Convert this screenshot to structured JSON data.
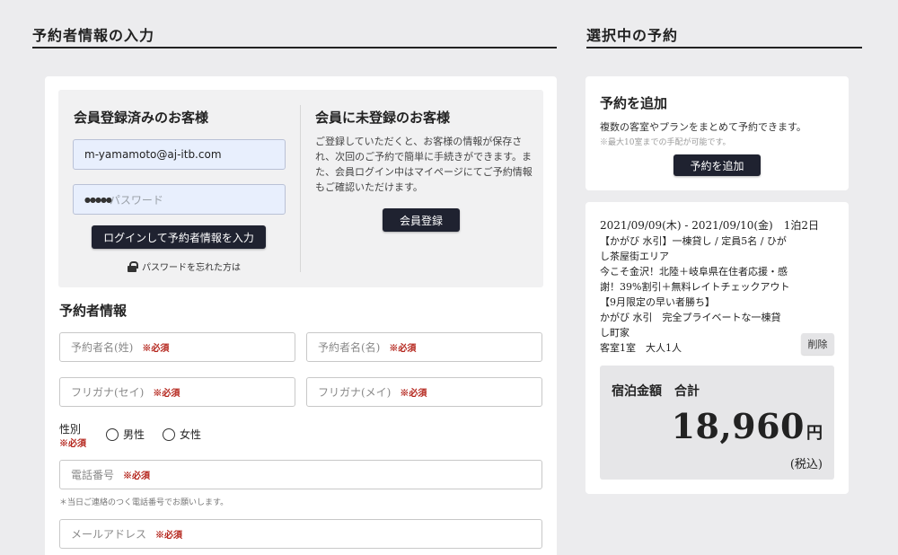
{
  "left_section": {
    "title": "予約者情報の入力"
  },
  "right_section": {
    "title": "選択中の予約"
  },
  "member_login": {
    "title": "会員登録済みのお客様",
    "email_value": "m-yamamoto@aj-itb.com",
    "password_placeholder": "パスワード",
    "password_value": "●●●●●",
    "login_button": "ログインして予約者情報を入力",
    "forgot_link": "パスワードを忘れた方は"
  },
  "guest": {
    "title": "会員に未登録のお客様",
    "description": [
      "ご登録していただくと、お客様の情報が保存さ",
      "れ、次回のご予約で簡単に手続きができます。ま",
      "た、会員ログイン中はマイページにてご予約情報",
      "もご確認いただけます。"
    ],
    "register_button": "会員登録"
  },
  "booker_info": {
    "title": "予約者情報",
    "required": "※必須",
    "last_name_placeholder": "予約者名(姓)",
    "first_name_placeholder": "予約者名(名)",
    "kana_last_placeholder": "フリガナ(セイ)",
    "kana_first_placeholder": "フリガナ(メイ)",
    "gender_label": "性別",
    "gender_options": [
      "男性",
      "女性"
    ],
    "phone_placeholder": "電話番号",
    "phone_hint": "＊当日ご連絡のつく電話番号でお願いします。",
    "email_placeholder": "メールアドレス"
  },
  "add_reservation": {
    "title": "予約を追加",
    "description": "複数の客室やプランをまとめて予約できます。",
    "note": "※最大10室までの手配が可能です。",
    "button": "予約を追加"
  },
  "reservation": {
    "dates": "2021/09/09(木) - 2021/09/10(金)　1泊2日",
    "details": [
      "【かがび 水引】一棟貸し / 定員5名 / ひが",
      "し茶屋街エリア",
      "今こそ金沢！北陸＋岐阜県在住者応援・感",
      "謝！39%割引＋無料レイトチェックアウト",
      "【9月限定の早い者勝ち】",
      "かがび 水引　完全プライベートな一棟貸",
      "し町家",
      "客室1室　大人1人"
    ],
    "delete_button": "削除",
    "price_label": "宿泊金額　合計",
    "price_value": "18,960",
    "price_unit": "円",
    "tax_note": "(税込)"
  }
}
